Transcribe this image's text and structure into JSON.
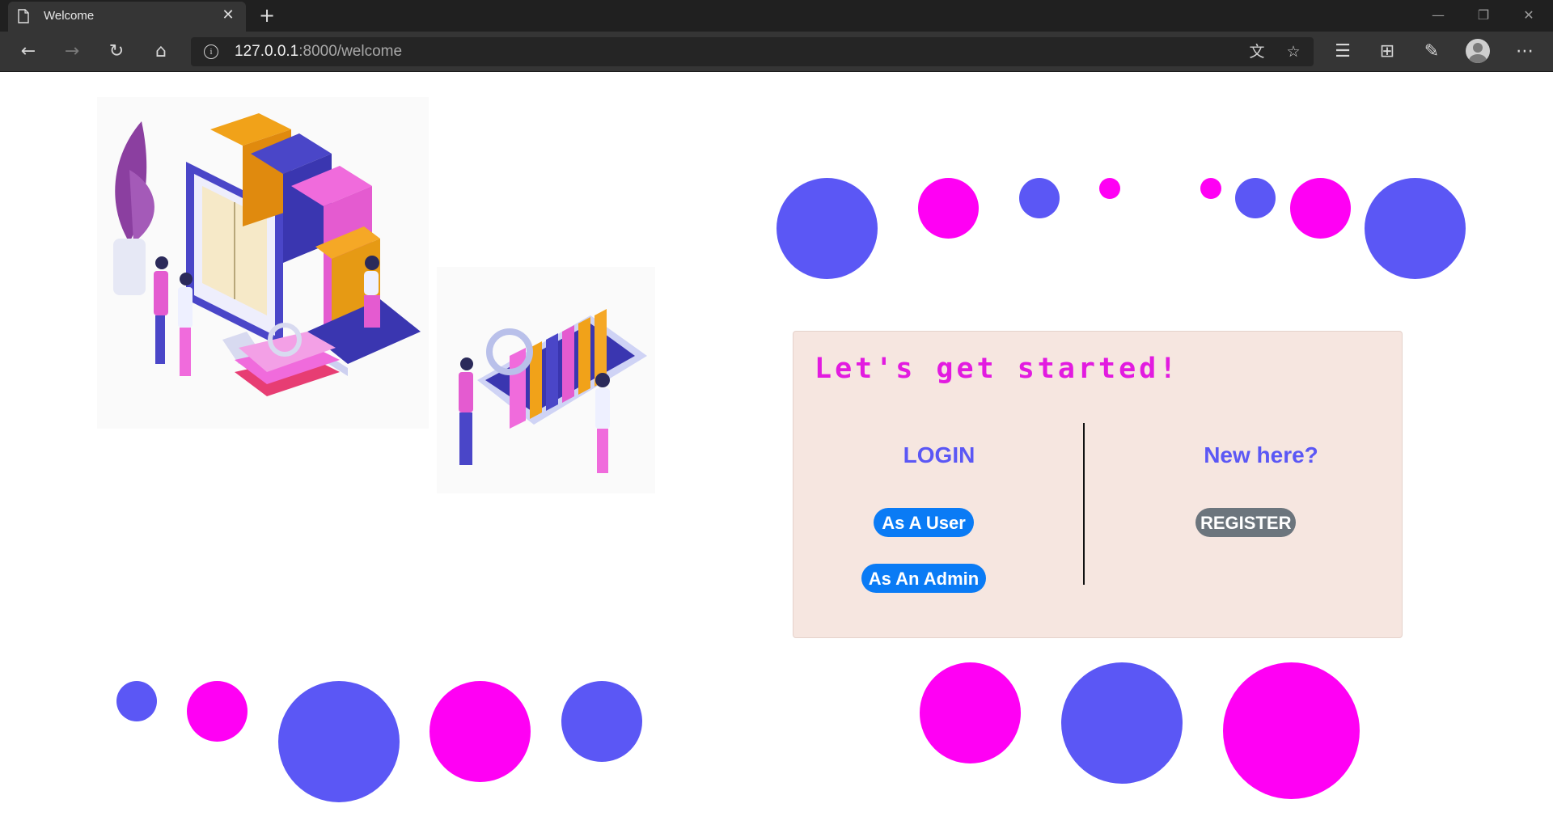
{
  "browser": {
    "tab_title": "Welcome",
    "url_host": "127.0.0.1",
    "url_path": ":8000/welcome",
    "icons": [
      "document-icon",
      "close-icon",
      "plus-icon",
      "back-icon",
      "forward-icon",
      "refresh-icon",
      "home-icon",
      "info-icon",
      "translate-icon",
      "star-icon",
      "favorites-icon",
      "collections-icon",
      "feedback-icon",
      "profile-icon",
      "more-icon",
      "minimize-icon",
      "restore-icon",
      "window-close-icon"
    ]
  },
  "card": {
    "title": "Let's get started!",
    "login_heading": "LOGIN",
    "user_button": "As A User",
    "admin_button": "As An Admin",
    "register_heading": "New here?",
    "register_button": "REGISTER"
  },
  "colors": {
    "blue": "#5b57f5",
    "pink": "#ff00f4",
    "card_bg": "#f6e6e0",
    "title": "#e21be0",
    "primary_button": "#0a7bf5",
    "secondary_button": "#6c757d"
  }
}
